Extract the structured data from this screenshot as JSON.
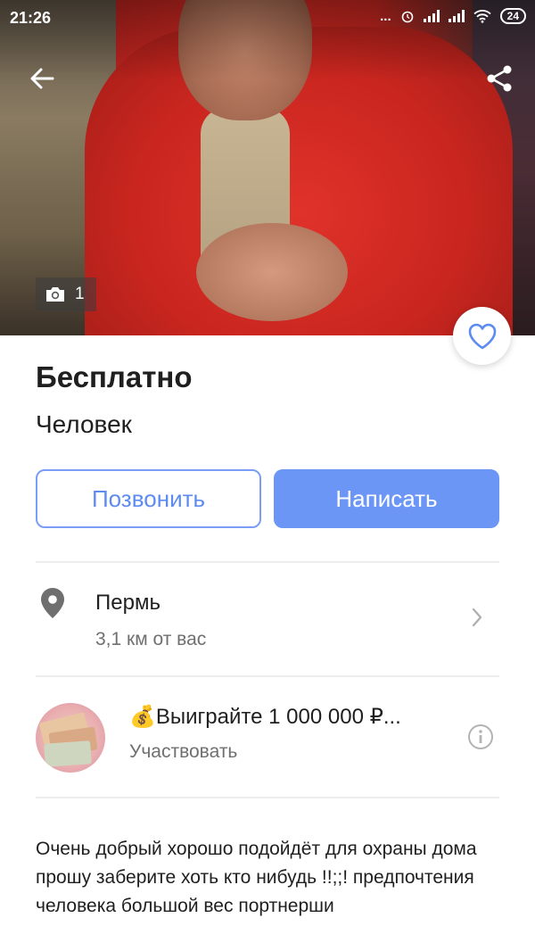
{
  "status_bar": {
    "time": "21:26",
    "dots": "...",
    "battery": "24"
  },
  "photo": {
    "count": "1",
    "back_icon": "arrow-left-icon",
    "share_icon": "share-icon",
    "favorite_icon": "heart-icon"
  },
  "listing": {
    "price": "Бесплатно",
    "title": "Человек"
  },
  "actions": {
    "call_label": "Позвонить",
    "message_label": "Написать",
    "accent_color": "#6b96f6"
  },
  "location": {
    "city": "Пермь",
    "distance": "3,1 км от вас"
  },
  "promo": {
    "title": "💰Выиграйте 1 000 000 ₽...",
    "subtitle": "Участвовать"
  },
  "description": "Очень добрый хорошо подойдёт для охраны дома прошу заберите хоть кто нибудь !!;;! предпочтения человека большой вес портнерши"
}
